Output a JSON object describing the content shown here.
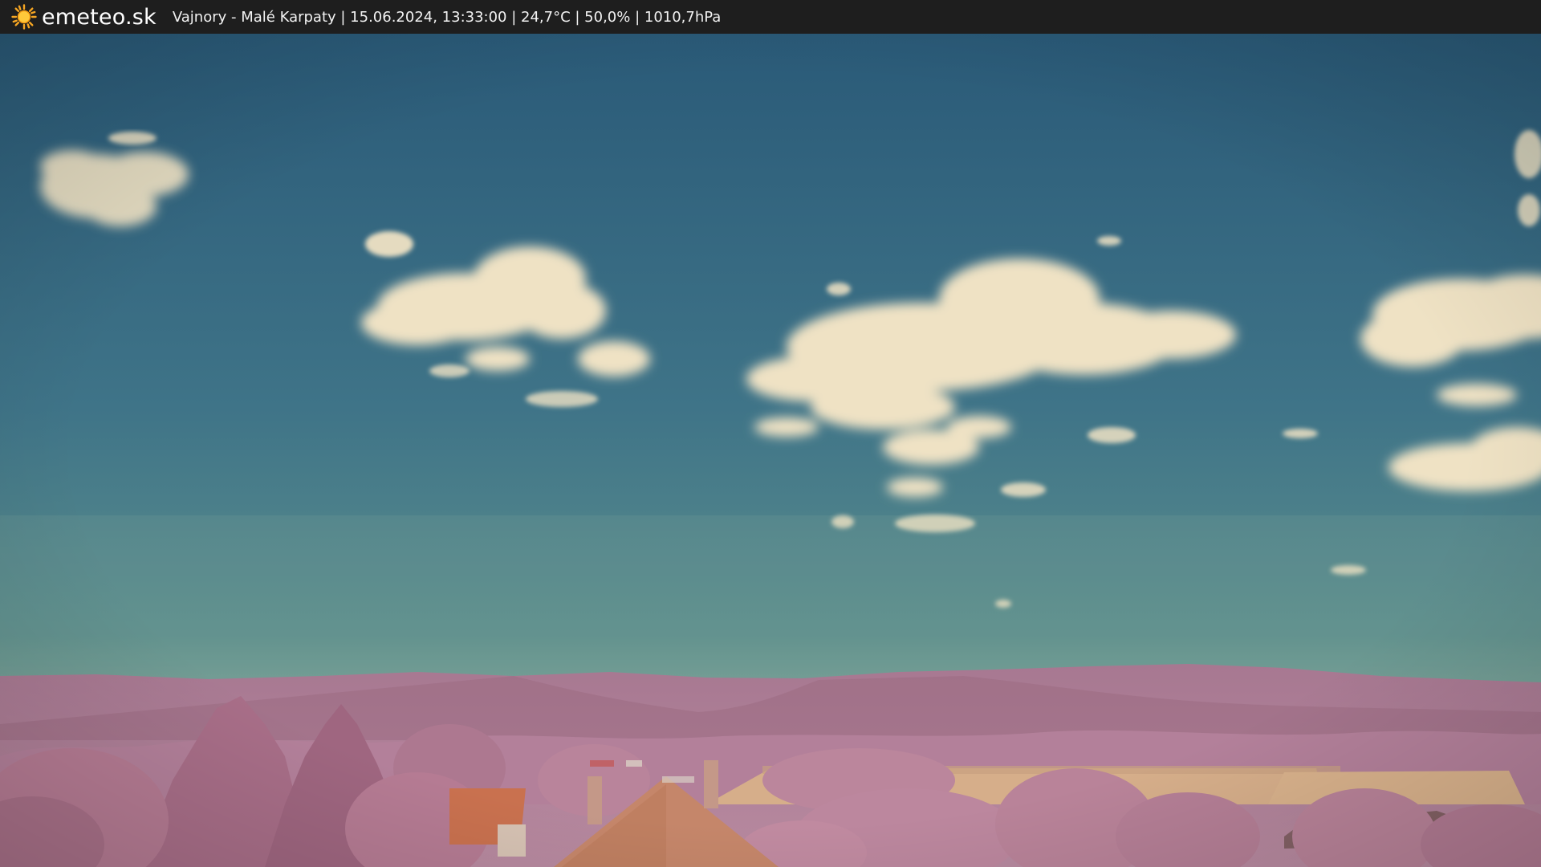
{
  "brand": {
    "name": "emeteo.sk",
    "icon": "sun-icon"
  },
  "caption": "Vajnory - Malé Karpaty | 15.06.2024, 13:33:00 | 24,7°C | 50,0% | 1010,7hPa",
  "colors": {
    "bar": "#1e1e1e",
    "sky_top": "#2a5a78",
    "sky_horizon": "#6f9a8f",
    "cloud": "#efe2c4",
    "hills": "#a87890",
    "trees": "#b47a92",
    "field": "#d5ad89",
    "roof": "#c9714f",
    "sun": "#f6a623"
  }
}
